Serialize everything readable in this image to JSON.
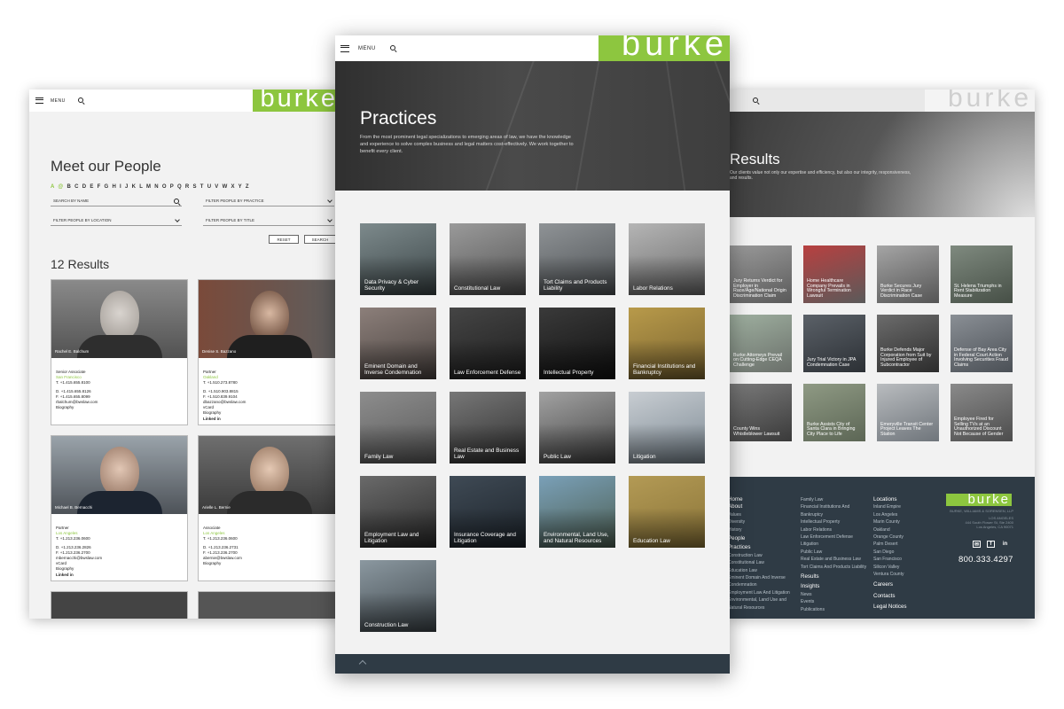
{
  "colors": {
    "brand_green": "#8dc63f",
    "footer_navy": "#2f3b45"
  },
  "people_page": {
    "menu_label": "MENU",
    "logo": "burke",
    "title": "Meet our People",
    "alphabet": {
      "active": "A",
      "at": "@",
      "rest": "B C D E F G H I J K L M N O P Q R S T U V W X Y Z"
    },
    "search_placeholder": "SEARCH BY NAME",
    "filter_practice": "FILTER PEOPLE BY PRACTICE",
    "filter_location": "FILTER PEOPLE BY LOCATION",
    "filter_title": "FILTER PEOPLE BY TITLE",
    "reset_label": "RESET",
    "search_label": "SEARCH",
    "results_count": "12 Results",
    "cards": [
      {
        "name": "Rachel E. Balchum",
        "title": "Senior Associate",
        "city": "San Francisco",
        "t": "T. +1.415.655.8100",
        "d": "D. +1.415.655.8126",
        "f": "F. +1.415.655.8099",
        "email": "rbalchum@bwslaw.com",
        "bio": "Biography",
        "vcard": "",
        "linkedin": ""
      },
      {
        "name": "Denise S. Bazzano",
        "title": "Partner",
        "city": "Oakland",
        "t": "T. +1.510.273.8780",
        "d": "D. +1.510.903.8815",
        "f": "F. +1.510.839.9104",
        "email": "dbazzano@bwslaw.com",
        "vcard": "vCard",
        "bio": "Biography",
        "linkedin": "Linked in"
      },
      {
        "name": "Michael B. Bernacchi",
        "title": "Partner",
        "city": "Los Angeles",
        "t": "T. +1.213.236.0600",
        "d": "D. +1.213.236.2826",
        "f": "F. +1.213.236.2700",
        "email": "mbernacchi@bwslaw.com",
        "vcard": "vCard",
        "bio": "Biography",
        "linkedin": "Linked in"
      },
      {
        "name": "Arielle L. Bernie",
        "title": "Associate",
        "city": "Los Angeles",
        "t": "T. +1.213.236.0600",
        "d": "D. +1.213.236.2731",
        "f": "F. +1.213.236.2700",
        "email": "abernie@bwslaw.com",
        "bio": "Biography",
        "vcard": "",
        "linkedin": ""
      }
    ]
  },
  "practices_page": {
    "menu_label": "MENU",
    "logo": "burke",
    "title": "Practices",
    "intro": "From the most prominent legal specializations to emerging areas of law, we have the knowledge and experience to solve complex business and legal matters cost-effectively. We work together to benefit every client.",
    "tiles": [
      "Data Privacy & Cyber Security",
      "Constitutional Law",
      "Tort Claims and Products Liability",
      "Labor Relations",
      "Eminent Domain and Inverse Condemnation",
      "Law Enforcement Defense",
      "Intellectual Property",
      "Financial Institutions and Bankruptcy",
      "Family Law",
      "Real Estate and Business Law",
      "Public Law",
      "Litigation",
      "Employment Law and Litigation",
      "Insurance Coverage and Litigation",
      "Environmental, Land Use, and Natural Resources",
      "Education Law",
      "Construction Law"
    ]
  },
  "results_page": {
    "logo": "burke",
    "title": "Results",
    "intro": "Our clients value not only our expertise and efficiency, but also our integrity, responsiveness, and results.",
    "tiles": [
      "Jury Returns Verdict for Employer in Race/Age/National Origin Discrimination Claim",
      "Home Healthcare Company Prevails in Wrongful Termination Lawsuit",
      "Burke Secures Jury Verdict in Race Discrimination Case",
      "St. Helena Triumphs in Rent Stabilization Measure",
      "Burke Attorneys Prevail on Cutting-Edge CEQA Challenge",
      "Jury Trial Victory in JPA Condemnation Case",
      "Burke Defends Major Corporation from Suit by Injured Employee of Subcontractor",
      "Defense of Bay Area City in Federal Court Action Involving Securities Fraud Claims",
      "County Wins Whistleblower Lawsuit",
      "Burke Assists City of Santa Clara in Bringing City Place to Life",
      "Emeryville Transit Center Project Leaves The Station",
      "Employee Fired for Selling TVs at an Unauthorized Discount Not Because of Gender"
    ],
    "footer": {
      "col1": {
        "home": "Home",
        "about": "About",
        "about_items": [
          "Values",
          "Diversity",
          "History"
        ],
        "people": "People",
        "practices": "Practices",
        "practice_items": [
          "Construction Law",
          "Constitutional Law",
          "Education Law",
          "Eminent Domain And Inverse Condemnation",
          "Employment Law And Litigation",
          "Environmental, Land Use and Natural Resources"
        ]
      },
      "col2": {
        "items": [
          "Family Law",
          "Financial Institutions And Bankruptcy",
          "Intellectual Property",
          "Labor Relations",
          "Law Enforcement Defense",
          "Litigation",
          "Public Law",
          "Real Estate and Business Law",
          "Tort Claims And Products Liability"
        ],
        "results": "Results",
        "insights": "Insights",
        "insight_items": [
          "News",
          "Events",
          "Publications"
        ]
      },
      "col3": {
        "locations": "Locations",
        "location_items": [
          "Inland Empire",
          "Los Angeles",
          "Marin County",
          "Oakland",
          "Orange County",
          "Palm Desert",
          "San Diego",
          "San Francisco",
          "Silicon Valley",
          "Ventura County"
        ],
        "careers": "Careers",
        "contacts": "Contacts",
        "legal": "Legal Notices"
      },
      "logo": "burke",
      "firm_name": "BURKE, WILLIAMS & SORENSEN, LLP",
      "address": [
        "LOS ANGELES",
        "444 South Flower St, Ste 2400",
        "Los Angeles, CA 90071"
      ],
      "social": [
        "mail-icon",
        "facebook-icon",
        "linkedin-icon"
      ],
      "phone": "800.333.4297"
    }
  }
}
